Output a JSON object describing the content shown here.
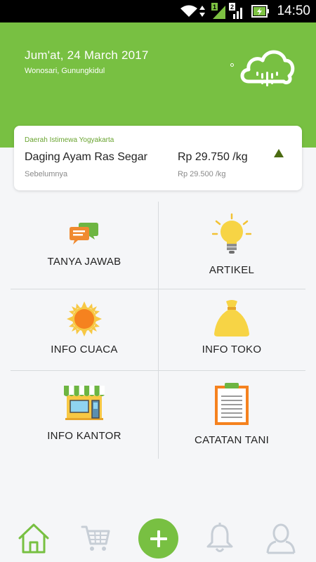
{
  "status_bar": {
    "time": "14:50"
  },
  "header": {
    "date": "Jum'at, 24 March 2017",
    "location": "Wonosari, Gunungkidul",
    "weather_icon": "rain-cloud-icon"
  },
  "price_card": {
    "region": "Daerah Istimewa Yogyakarta",
    "product": "Daging Ayam Ras Segar",
    "price": "Rp 29.750 /kg",
    "previous_label": "Sebelumnya",
    "previous_price": "Rp 29.500 /kg",
    "trend": "up",
    "trend_color": "#4b6b12"
  },
  "menu": {
    "tanya_jawab": "TANYA JAWAB",
    "artikel": "ARTIKEL",
    "info_cuaca": "INFO CUACA",
    "info_toko": "INFO TOKO",
    "info_kantor": "INFO KANTOR",
    "catatan_tani": "CATATAN TANI"
  },
  "bottom_nav": {
    "items": [
      "home-icon",
      "cart-icon",
      "add-icon",
      "bell-icon",
      "profile-icon"
    ]
  },
  "colors": {
    "brand_green": "#78c042",
    "nav_gray": "#c7ced6"
  }
}
